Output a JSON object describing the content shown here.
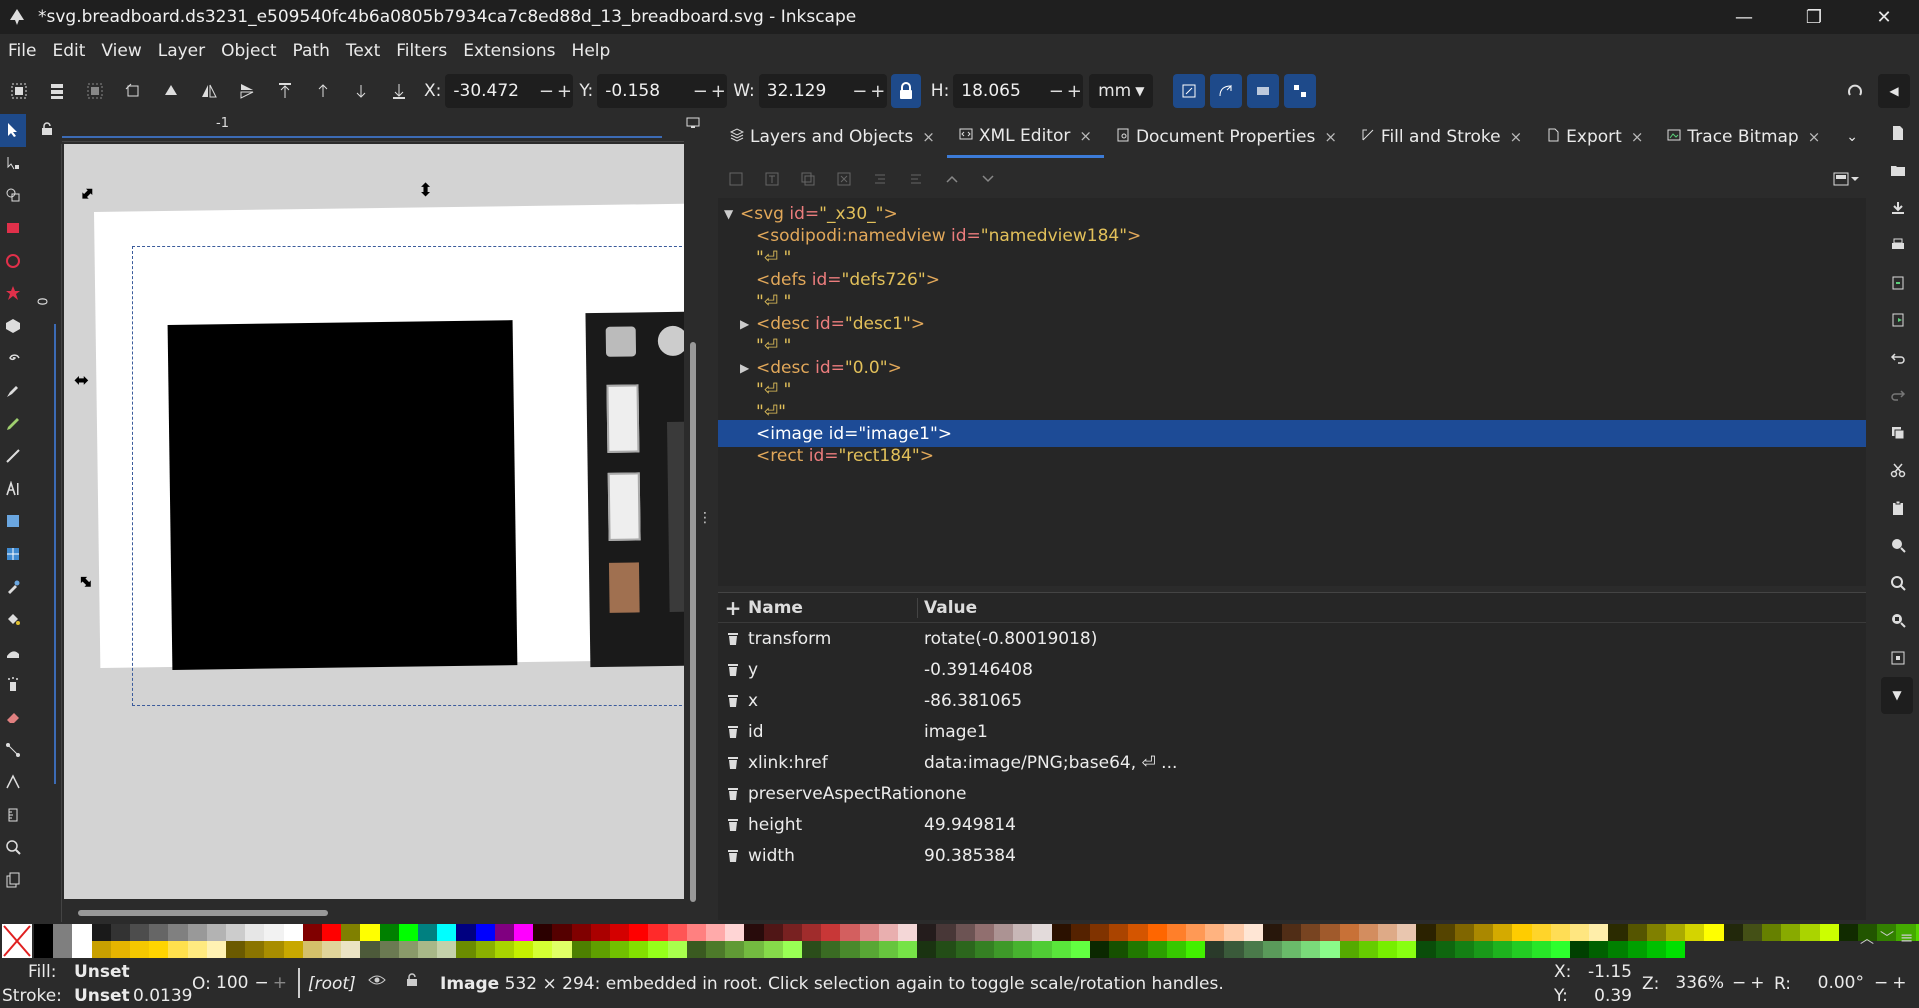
{
  "window": {
    "title": "*svg.breadboard.ds3231_e509540fc4b6a0805b7934ca7c8ed88d_13_breadboard.svg - Inkscape",
    "minimize": "—",
    "maximize": "❐",
    "close": "✕"
  },
  "menu": [
    "File",
    "Edit",
    "View",
    "Layer",
    "Object",
    "Path",
    "Text",
    "Filters",
    "Extensions",
    "Help"
  ],
  "toolbar": {
    "x_label": "X:",
    "x_value": "-30.472",
    "y_label": "Y:",
    "y_value": "-0.158",
    "w_label": "W:",
    "w_value": "32.129",
    "h_label": "H:",
    "h_value": "18.065",
    "units": "mm",
    "minus": "−",
    "plus": "+"
  },
  "ruler": {
    "h_label": "-1",
    "v_label": "0"
  },
  "tabs": [
    {
      "label": "Layers and Objects",
      "icon": "layers-icon",
      "active": false
    },
    {
      "label": "XML Editor",
      "icon": "xml-icon",
      "active": true
    },
    {
      "label": "Document Properties",
      "icon": "document-icon",
      "active": false
    },
    {
      "label": "Fill and Stroke",
      "icon": "brush-icon",
      "active": false
    },
    {
      "label": "Export",
      "icon": "export-icon",
      "active": false
    },
    {
      "label": "Trace Bitmap",
      "icon": "trace-icon",
      "active": false
    }
  ],
  "tab_close": "×",
  "xml_nodes": {
    "n0": {
      "tag": "<svg",
      "attr": " id=",
      "val": "\"_x30_\"",
      "end": ">"
    },
    "n1": {
      "tag": "<sodipodi:namedview",
      "attr": " id=",
      "val": "\"namedview184\"",
      "end": ">"
    },
    "n2": {
      "text": "\"⏎  \""
    },
    "n3": {
      "tag": "<defs",
      "attr": " id=",
      "val": "\"defs726\"",
      "end": ">"
    },
    "n4": {
      "text": "\"⏎  \""
    },
    "n5": {
      "tag": "<desc",
      "attr": " id=",
      "val": "\"desc1\"",
      "end": ">"
    },
    "n6": {
      "text": "\"⏎  \""
    },
    "n7": {
      "tag": "<desc",
      "attr": " id=",
      "val": "\"0.0\"",
      "end": ">"
    },
    "n8": {
      "text": "\"⏎  \""
    },
    "n9": {
      "text": "\"⏎\""
    },
    "n10": {
      "label": "<image id=\"image1\">"
    },
    "n11": {
      "tag": "<rect",
      "attr": " id=",
      "val": "\"rect184\"",
      "end": ">"
    }
  },
  "attributes": {
    "header_add": "+",
    "header_name": "Name",
    "header_value": "Value",
    "rows": [
      {
        "name": "transform",
        "value": "rotate(-0.80019018)"
      },
      {
        "name": "y",
        "value": "-0.39146408"
      },
      {
        "name": "x",
        "value": "-86.381065"
      },
      {
        "name": "id",
        "value": "image1"
      },
      {
        "name": "xlink:href",
        "value": "data:image/PNG;base64,  ⏎ ..."
      },
      {
        "name": "preserveAspectRatio",
        "value": "none"
      },
      {
        "name": "height",
        "value": "49.949814"
      },
      {
        "name": "width",
        "value": "90.385384"
      }
    ]
  },
  "status": {
    "fill_label": "Fill:",
    "fill_value": "Unset",
    "stroke_label": "Stroke:",
    "stroke_value": "Unset",
    "stroke_width": "0.0139",
    "opacity_label": "O:",
    "opacity_value": "100",
    "layer": "[root]",
    "message_bold": "Image",
    "message": " 532 × 294: embedded in root. Click selection again to toggle scale/rotation handles.",
    "cx_label": "X:",
    "cx_value": "-1.15",
    "cy_label": "Y:",
    "cy_value": "0.39",
    "zoom_label": "Z:",
    "zoom_value": "336%",
    "rot_label": "R:",
    "rot_value": "0.00°"
  },
  "colors": {
    "accent": "#1e4a8a",
    "selection": "#1d4b96",
    "xml_tag": "#e2a85a",
    "xml_attr": "#ec7d7d",
    "xml_value": "#e2c05a"
  }
}
